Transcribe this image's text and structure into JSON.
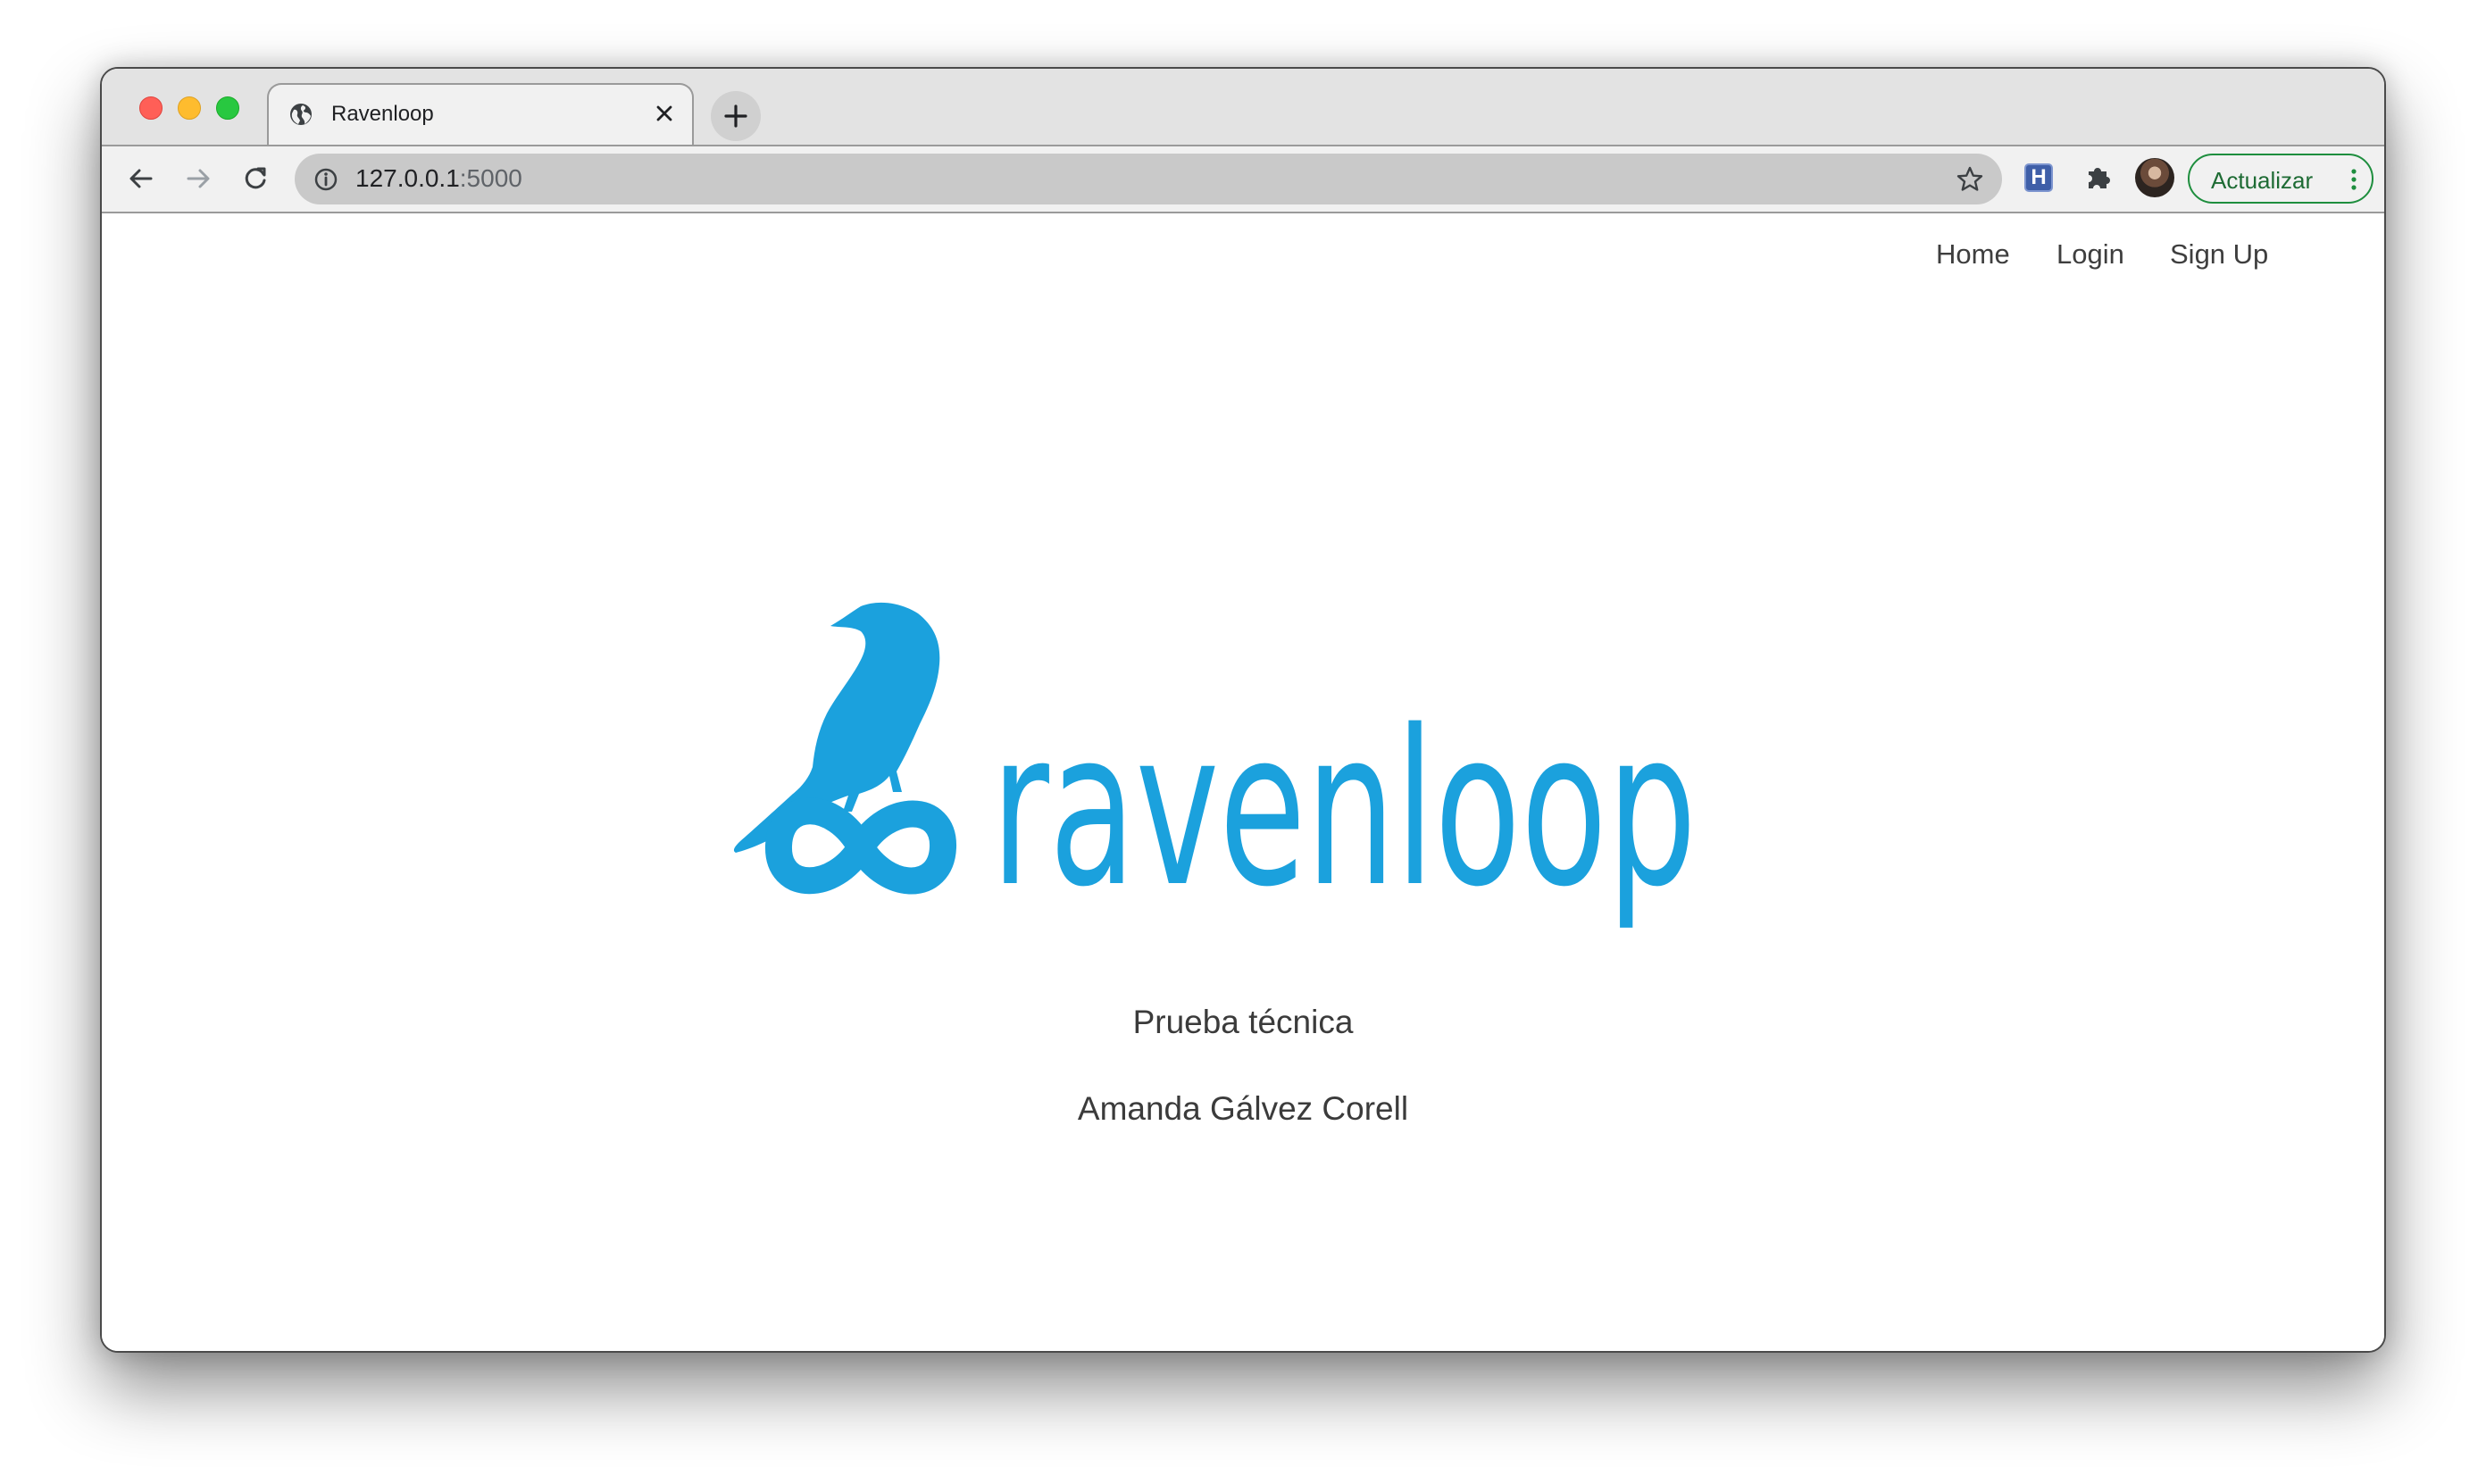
{
  "browser": {
    "tab": {
      "title": "Ravenloop",
      "favicon_icon": "globe-icon",
      "close_icon": "close-icon"
    },
    "new_tab_icon": "plus-icon",
    "toolbar": {
      "back_icon": "back-arrow-icon",
      "forward_icon": "forward-arrow-icon",
      "reload_icon": "reload-icon",
      "url_host": "127.0.0.1",
      "url_port": ":5000",
      "site_info_icon": "info-icon",
      "bookmark_icon": "star-icon",
      "extension_h_label": "H",
      "extensions_icon": "puzzle-icon",
      "update_label": "Actualizar",
      "menu_icon": "three-dots-vertical-icon"
    }
  },
  "page": {
    "nav": {
      "home": "Home",
      "login": "Login",
      "signup": "Sign Up"
    },
    "logo_text": "ravenloop",
    "subtitle": "Prueba técnica",
    "author": "Amanda Gálvez Corell",
    "brand_color": "#1ba1dd"
  }
}
